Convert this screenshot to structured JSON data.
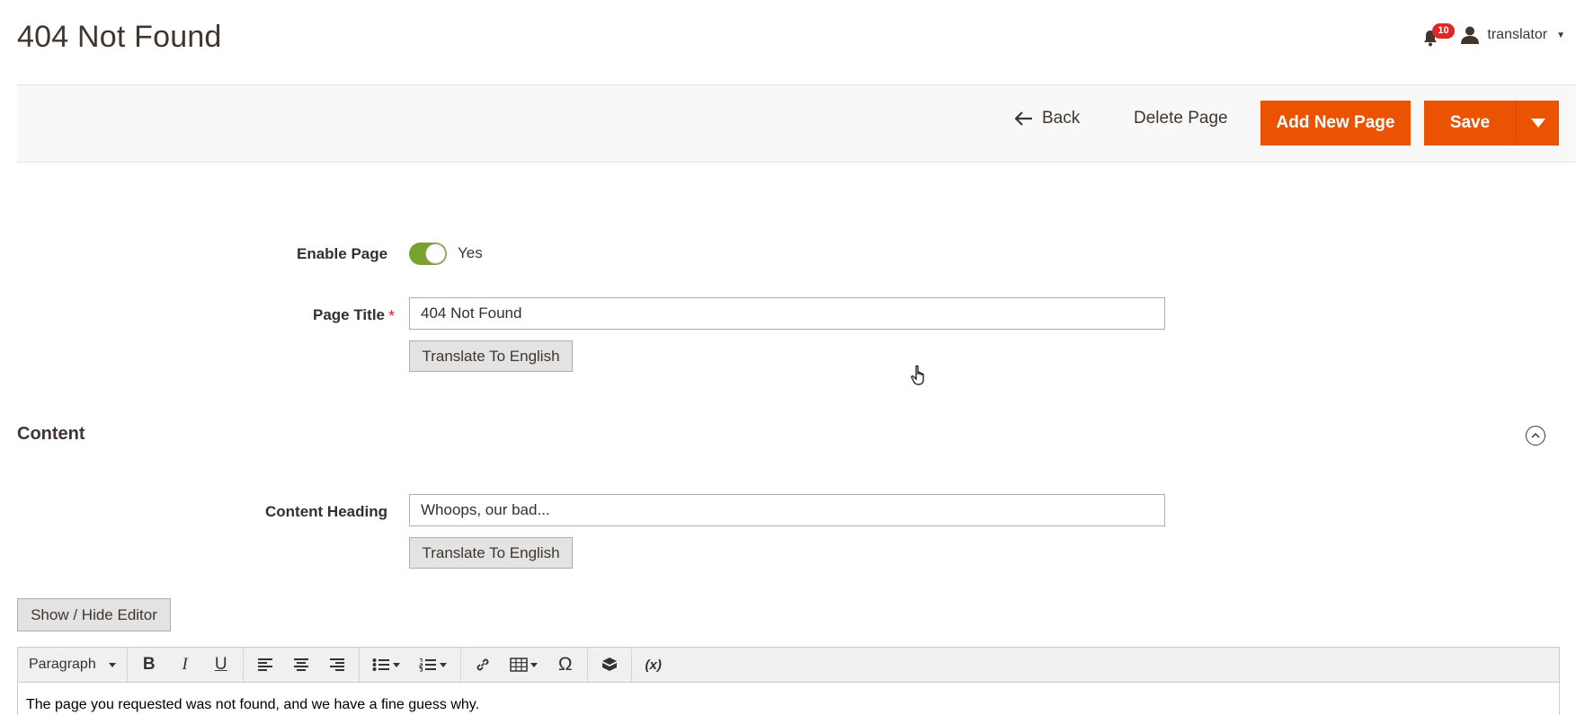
{
  "header": {
    "page_title": "404 Not Found",
    "notifications_count": "10",
    "user_name": "translator"
  },
  "actions": {
    "back_label": "Back",
    "delete_label": "Delete Page",
    "add_new_label": "Add New Page",
    "save_label": "Save"
  },
  "form": {
    "enable_page": {
      "label": "Enable Page",
      "value": "Yes",
      "enabled": true
    },
    "page_title": {
      "label": "Page Title",
      "required_mark": "*",
      "value": "404 Not Found",
      "translate_label": "Translate To English"
    }
  },
  "content_section": {
    "title": "Content",
    "heading": {
      "label": "Content Heading",
      "value": "Whoops, our bad...",
      "translate_label": "Translate To English"
    },
    "show_hide_label": "Show / Hide Editor",
    "editor": {
      "format_select": "Paragraph",
      "body_text": "The page you requested was not found, and we have a fine guess why."
    }
  },
  "colors": {
    "primary": "#eb5202",
    "toggle_on": "#79a22e",
    "badge": "#e22626"
  }
}
